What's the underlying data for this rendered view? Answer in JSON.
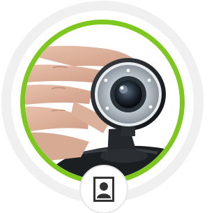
{
  "avatar": {
    "subject": "webcam-held-in-hand",
    "ring_color": "#7dc71f",
    "outer_ring_color": "#f0f0f0"
  },
  "badge": {
    "icon": "contact-card-icon",
    "icon_color": "#333333"
  }
}
